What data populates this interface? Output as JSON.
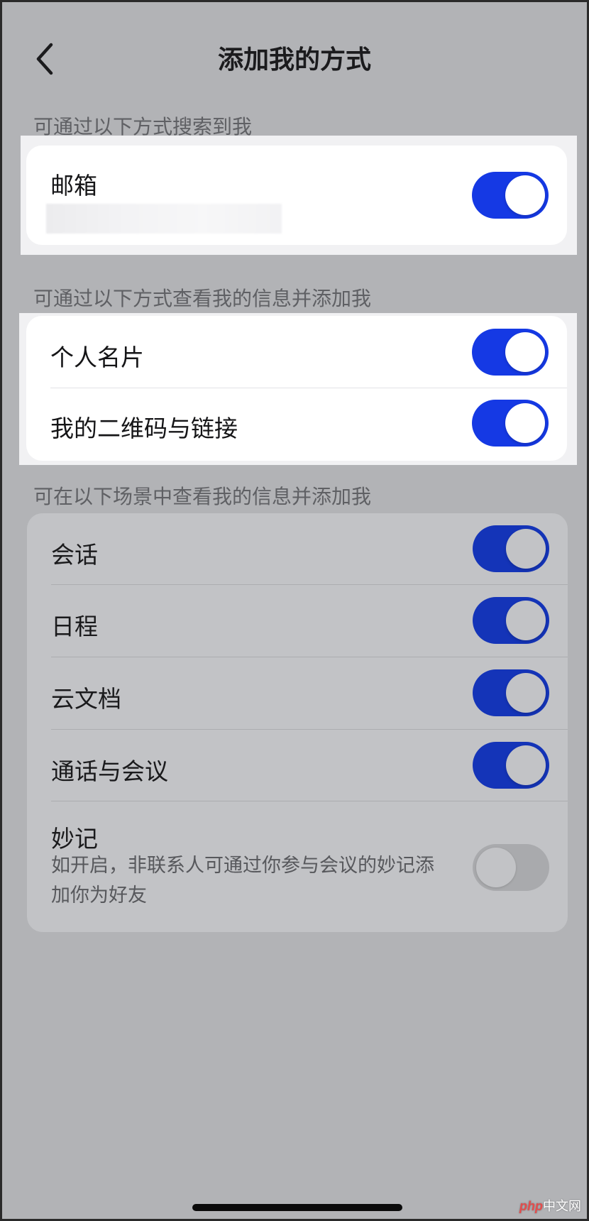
{
  "nav": {
    "title": "添加我的方式",
    "back_icon": "chevron-left-icon"
  },
  "colors": {
    "accent": "#1539e4",
    "accent_dim": "#1434b8",
    "overlay": "#b2b3b6"
  },
  "sections": {
    "search": {
      "header": "可通过以下方式搜索到我",
      "items": [
        {
          "label": "邮箱",
          "value_redacted": true,
          "enabled": true
        }
      ]
    },
    "view_add": {
      "header": "可通过以下方式查看我的信息并添加我",
      "items": [
        {
          "label": "个人名片",
          "enabled": true
        },
        {
          "label": "我的二维码与链接",
          "enabled": true
        }
      ]
    },
    "scenes": {
      "header": "可在以下场景中查看我的信息并添加我",
      "items": [
        {
          "label": "会话",
          "enabled": true
        },
        {
          "label": "日程",
          "enabled": true
        },
        {
          "label": "云文档",
          "enabled": true
        },
        {
          "label": "通话与会议",
          "enabled": true
        },
        {
          "label": "妙记",
          "description": "如开启，非联系人可通过你参与会议的妙记添加你为好友",
          "enabled": false
        }
      ]
    }
  },
  "watermark": {
    "php": "php",
    "site": "中文网"
  }
}
